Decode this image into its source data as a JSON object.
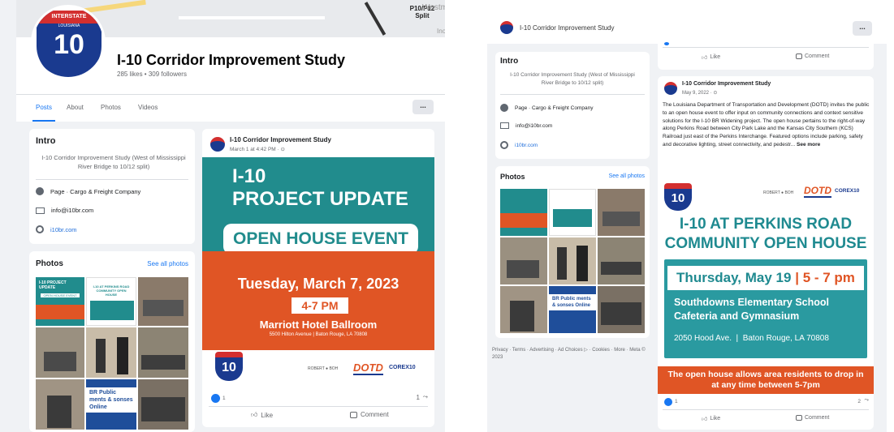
{
  "left": {
    "map_labels": {
      "interstate": "INTERSTATE",
      "louisiana": "LOUISIANA",
      "split": "Split",
      "split_top": "P10/P12",
      "place": "Westmin",
      "inois": "Inois"
    },
    "page": {
      "name": "I-10 Corridor Improvement Study",
      "stats": "285 likes • 309 followers",
      "shield_number": "10"
    },
    "tabs": [
      "Posts",
      "About",
      "Photos",
      "Videos"
    ],
    "more_button": "...",
    "intro": {
      "title": "Intro",
      "bio": "I-10 Corridor Improvement Study (West of Mississippi River Bridge to 10/12 split)",
      "category": "Page · Cargo & Freight Company",
      "email": "info@i10br.com",
      "website": "i10br.com"
    },
    "photos": {
      "title": "Photos",
      "see_all": "See all photos",
      "thumb1_title": "I-10 PROJECT UPDATE",
      "thumb1_sub": "OPEN HOUSE EVENT",
      "thumb2_title": "I-10 AT PERKINS ROAD COMMUNITY OPEN HOUSE",
      "thumb_br": "BR Public ments & sonses Online"
    },
    "post": {
      "author": "I-10 Corridor Improvement Study",
      "time": "March 1 at 4:42 PM · ⊙",
      "headline1": "I-10",
      "headline2": "PROJECT UPDATE",
      "event": "OPEN HOUSE EVENT",
      "date": "Tuesday, March 7, 2023",
      "time_range": "4-7 PM",
      "venue": "Marriott Hotel Ballroom",
      "address": "5500 Hilton Avenue | Baton Rouge, LA 70808",
      "logo_dotd": "DOTD",
      "logo_corex": "COREX10",
      "logo_robert": "ROBERT ● BOH",
      "reaction_count": "1",
      "share_count": "1",
      "like": "Like",
      "comment": "Comment"
    }
  },
  "right": {
    "header_title": "I-10 Corridor Improvement Study",
    "more_button": "...",
    "intro": {
      "title": "Intro",
      "bio": "I-10 Corridor Improvement Study (West of Mississippi River Bridge to 10/12 split)",
      "category": "Page · Cargo & Freight Company",
      "email": "info@i10br.com",
      "website": "i10br.com"
    },
    "photos": {
      "title": "Photos",
      "see_all": "See all photos",
      "thumb_br": "BR Public ments & sonses Online"
    },
    "footer": "Privacy · Terms · Advertising · Ad Choices ▷ · Cookies · More · Meta © 2023",
    "top_actions": {
      "like": "Like",
      "comment": "Comment"
    },
    "post": {
      "author": "I-10 Corridor Improvement Study",
      "time": "May 9, 2022 · ⊙",
      "body": "The Louisiana Department of Transportation and Development (DOTD) invites the public to an open house event to offer input on community connections and context sensitive solutions for the I-10 BR Widening project. The open house pertains to the right-of-way along Perkins Road between City Park Lake and the Kansas City Southern (KCS) Railroad just east of the Perkins Interchange. Featured options include parking, safety and decorative lighting, street connectivity, and pedestr...",
      "see_more": "See more",
      "headline1": "I-10 AT PERKINS ROAD",
      "headline2": "COMMUNITY OPEN HOUSE",
      "date": "Thursday, May 19",
      "sep": "|",
      "time_range": "5 - 7 pm",
      "school1": "Southdowns Elementary School",
      "school2": "Cafeteria and Gymnasium",
      "address": "2050 Hood Ave.  |  Baton Rouge, LA 70808",
      "banner": "The open house allows area residents to drop in at any time between 5-7pm",
      "logo_dotd": "DOTD",
      "logo_corex": "COREX10",
      "logo_robert": "ROBERT ● BOH",
      "reaction_count": "1",
      "share_count": "2",
      "like": "Like",
      "comment": "Comment"
    }
  }
}
